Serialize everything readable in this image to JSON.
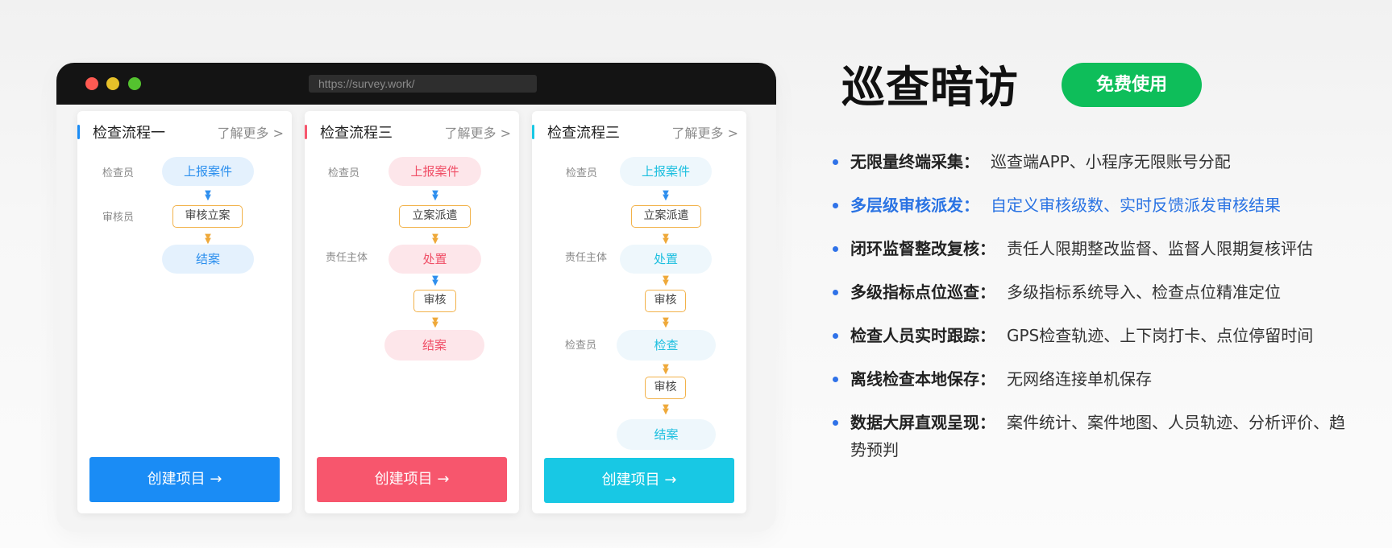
{
  "browser": {
    "url": "https://survey.work/"
  },
  "cards": [
    {
      "title": "检查流程一",
      "more": "了解更多 >",
      "accent": "#1a8cf5",
      "roles": [
        "检查员",
        "审核员"
      ],
      "steps": [
        "上报案件",
        "审核立案",
        "结案"
      ],
      "button": "创建项目 →"
    },
    {
      "title": "检查流程三",
      "more": "了解更多 >",
      "accent": "#f7566d",
      "roles": [
        "检查员",
        "责任主体"
      ],
      "steps": [
        "上报案件",
        "立案派遣",
        "处置",
        "审核",
        "结案"
      ],
      "button": "创建项目 →"
    },
    {
      "title": "检查流程三",
      "more": "了解更多 >",
      "accent": "#18c8e4",
      "roles": [
        "检查员",
        "责任主体",
        "检查员"
      ],
      "steps": [
        "上报案件",
        "立案派遣",
        "处置",
        "审核",
        "检查",
        "审核",
        "结案"
      ],
      "button": "创建项目 →"
    }
  ],
  "hero": {
    "title": "巡查暗访",
    "free_button": "免费使用"
  },
  "features": [
    {
      "label": "无限量终端采集",
      "colon": "：",
      "text": "巡查端APP、小程序无限账号分配"
    },
    {
      "label": "多层级审核派发",
      "colon": "：",
      "text": "自定义审核级数、实时反馈派发审核结果"
    },
    {
      "label": "闭环监督整改复核",
      "colon": "：",
      "text": "责任人限期整改监督、监督人限期复核评估"
    },
    {
      "label": "多级指标点位巡查",
      "colon": "：",
      "text": "多级指标系统导入、检查点位精准定位"
    },
    {
      "label": "检查人员实时跟踪",
      "colon": "：",
      "text": "GPS检查轨迹、上下岗打卡、点位停留时间"
    },
    {
      "label": "离线检查本地保存",
      "colon": "：",
      "text": "无网络连接单机保存"
    },
    {
      "label": "数据大屏直观呈现",
      "colon": "：",
      "text": "案件统计、案件地图、人员轨迹、分析评价、趋势预判"
    }
  ],
  "colors": {
    "brand_green": "#0ebe5a",
    "highlight_blue": "#2a73e3"
  }
}
